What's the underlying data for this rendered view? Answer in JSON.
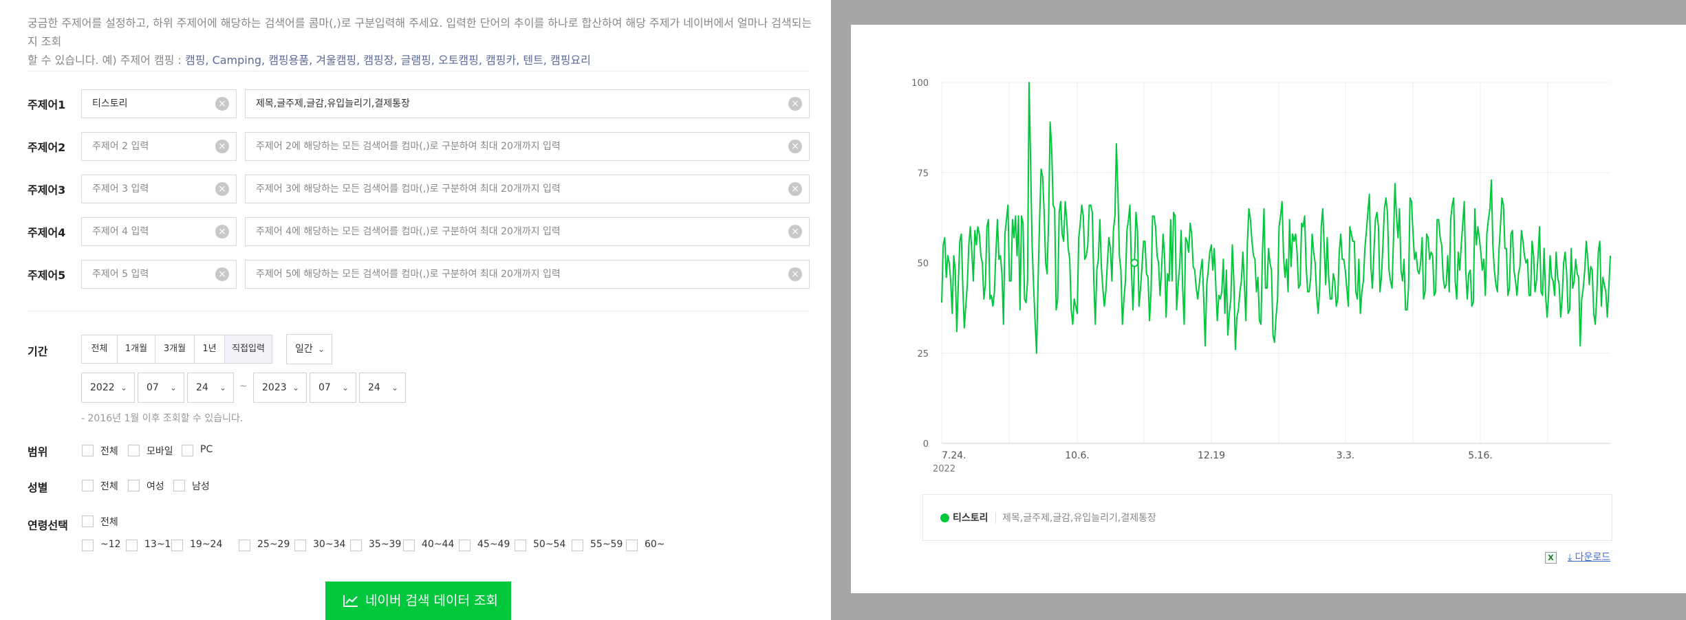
{
  "intro": {
    "line1": "궁금한 주제어를 설정하고, 하위 주제어에 해당하는 검색어를 콤마(,)로 구분입력해 주세요. 입력한 단어의 추이를 하나로 합산하여 해당 주제가 네이버에서 얼마나 검색되는지 조회",
    "line2_prefix": "할 수 있습니다. 예) 주제어 캠핑 : ",
    "line2_example": "캠핑, Camping, 캠핑용품, 겨울캠핑, 캠핑장, 글램핑, 오토캠핑, 캠핑카, 텐트, 캠핑요리"
  },
  "topics": [
    {
      "label": "주제어1",
      "name": "티스토리",
      "name_placeholder": "주제어 1 입력",
      "keywords": "제목,글주제,글감,유입늘리기,결제통장",
      "keywords_placeholder": ""
    },
    {
      "label": "주제어2",
      "name": "",
      "name_placeholder": "주제어 2 입력",
      "keywords": "",
      "keywords_placeholder": "주제어 2에 해당하는 모든 검색어를 컴마(,)로 구분하여 최대 20개까지 입력"
    },
    {
      "label": "주제어3",
      "name": "",
      "name_placeholder": "주제어 3 입력",
      "keywords": "",
      "keywords_placeholder": "주제어 3에 해당하는 모든 검색어를 컴마(,)로 구분하여 최대 20개까지 입력"
    },
    {
      "label": "주제어4",
      "name": "",
      "name_placeholder": "주제어 4 입력",
      "keywords": "",
      "keywords_placeholder": "주제어 4에 해당하는 모든 검색어를 컴마(,)로 구분하여 최대 20개까지 입력"
    },
    {
      "label": "주제어5",
      "name": "",
      "name_placeholder": "주제어 5 입력",
      "keywords": "",
      "keywords_placeholder": "주제어 5에 해당하는 모든 검색어를 컴마(,)로 구분하여 최대 20개까지 입력"
    }
  ],
  "period": {
    "label": "기간",
    "buttons": [
      "전체",
      "1개월",
      "3개월",
      "1년",
      "직접입력"
    ],
    "active": "직접입력",
    "unit": "일간",
    "start": {
      "year": "2022",
      "month": "07",
      "day": "24"
    },
    "end": {
      "year": "2023",
      "month": "07",
      "day": "24"
    },
    "separator": "~",
    "note": "- 2016년 1월 이후 조회할 수 있습니다."
  },
  "scope": {
    "label": "범위",
    "options": [
      "전체",
      "모바일",
      "PC"
    ]
  },
  "gender": {
    "label": "성별",
    "options": [
      "전체",
      "여성",
      "남성"
    ]
  },
  "age": {
    "label": "연령선택",
    "all": "전체",
    "options": [
      "~12",
      "13~18",
      "19~24",
      "25~29",
      "30~34",
      "35~39",
      "40~44",
      "45~49",
      "50~54",
      "55~59",
      "60~"
    ]
  },
  "submit_label": "네이버 검색 데이터 조회",
  "legend": {
    "name": "티스토리",
    "keywords": "제목,글주제,글감,유입늘리기,결제통장"
  },
  "download_label": "다운로드",
  "colors": {
    "accent": "#00c73c",
    "grid": "#eeeeee",
    "link": "#3e6bd6"
  },
  "chart_data": {
    "type": "line",
    "title": "",
    "xlabel": "",
    "ylabel": "",
    "ylim": [
      0,
      100
    ],
    "yticks": [
      "0",
      "25",
      "50",
      "75",
      "100"
    ],
    "x_tick_labels": [
      "7.24.",
      "10.6.",
      "12.19",
      "3.3.",
      "5.16."
    ],
    "x_tick_sublabel": "2022",
    "x_start": "2022-07-24",
    "x_end": "2023-07-24",
    "series": [
      {
        "name": "티스토리",
        "values": [
          39,
          55,
          57,
          46,
          52,
          50,
          45,
          36,
          52,
          48,
          31,
          44,
          56,
          58,
          44,
          32,
          38,
          44,
          55,
          60,
          53,
          45,
          59,
          55,
          60,
          58,
          52,
          50,
          40,
          44,
          60,
          62,
          40,
          41,
          38,
          42,
          53,
          62,
          51,
          52,
          47,
          33,
          58,
          62,
          66,
          45,
          45,
          62,
          57,
          63,
          52,
          63,
          37,
          63,
          61,
          40,
          39,
          45,
          100,
          78,
          55,
          44,
          34,
          25,
          45,
          62,
          76,
          74,
          64,
          50,
          47,
          62,
          89,
          82,
          66,
          65,
          37,
          40,
          64,
          67,
          58,
          56,
          67,
          62,
          54,
          51,
          37,
          33,
          40,
          38,
          36,
          57,
          61,
          66,
          63,
          51,
          52,
          55,
          66,
          66,
          64,
          45,
          33,
          48,
          51,
          62,
          49,
          43,
          38,
          42,
          50,
          57,
          54,
          45,
          59,
          63,
          83,
          70,
          52,
          48,
          33,
          40,
          45,
          59,
          62,
          66,
          48,
          37,
          50,
          64,
          59,
          38,
          43,
          49,
          56,
          56,
          47,
          46,
          34,
          42,
          63,
          63,
          60,
          52,
          50,
          41,
          48,
          58,
          52,
          35,
          47,
          45,
          62,
          45,
          64,
          63,
          37,
          44,
          49,
          59,
          43,
          33,
          57,
          56,
          53,
          61,
          58,
          49,
          48,
          43,
          40,
          44,
          48,
          51,
          40,
          27,
          44,
          48,
          53,
          55,
          48,
          54,
          44,
          34,
          41,
          40,
          42,
          51,
          36,
          48,
          30,
          36,
          40,
          55,
          45,
          26,
          35,
          37,
          42,
          45,
          53,
          44,
          34,
          56,
          65,
          62,
          56,
          52,
          51,
          42,
          46,
          34,
          33,
          53,
          65,
          43,
          43,
          54,
          50,
          48,
          30,
          28,
          35,
          40,
          60,
          63,
          67,
          52,
          46,
          51,
          42,
          62,
          49,
          58,
          56,
          58,
          53,
          43,
          44,
          61,
          60,
          63,
          49,
          42,
          42,
          46,
          58,
          53,
          50,
          41,
          36,
          43,
          60,
          65,
          54,
          44,
          57,
          46,
          40,
          40,
          47,
          45,
          38,
          40,
          53,
          58,
          51,
          51,
          48,
          43,
          38,
          60,
          58,
          56,
          56,
          42,
          40,
          51,
          36,
          42,
          45,
          54,
          59,
          64,
          69,
          49,
          43,
          53,
          62,
          64,
          60,
          42,
          46,
          55,
          65,
          68,
          64,
          48,
          45,
          43,
          57,
          72,
          63,
          57,
          65,
          48,
          45,
          51,
          37,
          37,
          43,
          68,
          67,
          58,
          51,
          53,
          48,
          47,
          50,
          57,
          40,
          42,
          58,
          57,
          51,
          53,
          52,
          41,
          42,
          62,
          62,
          57,
          55,
          46,
          43,
          44,
          52,
          42,
          62,
          66,
          68,
          45,
          40,
          53,
          48,
          55,
          61,
          67,
          48,
          40,
          47,
          48,
          38,
          39,
          65,
          55,
          60,
          57,
          53,
          48,
          51,
          41,
          58,
          62,
          65,
          73,
          55,
          48,
          44,
          42,
          53,
          60,
          68,
          66,
          54,
          54,
          41,
          43,
          58,
          59,
          48,
          45,
          41,
          47,
          49,
          59,
          56,
          52,
          50,
          51,
          41,
          41,
          56,
          52,
          42,
          45,
          52,
          60,
          42,
          41,
          54,
          41,
          35,
          41,
          52,
          46,
          45,
          41,
          53,
          46,
          44,
          35,
          40,
          50,
          53,
          47,
          36,
          37,
          54,
          43,
          45,
          51,
          47,
          46,
          27,
          40,
          43,
          48,
          56,
          51,
          44,
          49,
          48,
          36,
          33,
          41,
          53,
          56,
          38,
          46,
          44,
          42,
          35,
          43,
          52
        ]
      }
    ]
  }
}
